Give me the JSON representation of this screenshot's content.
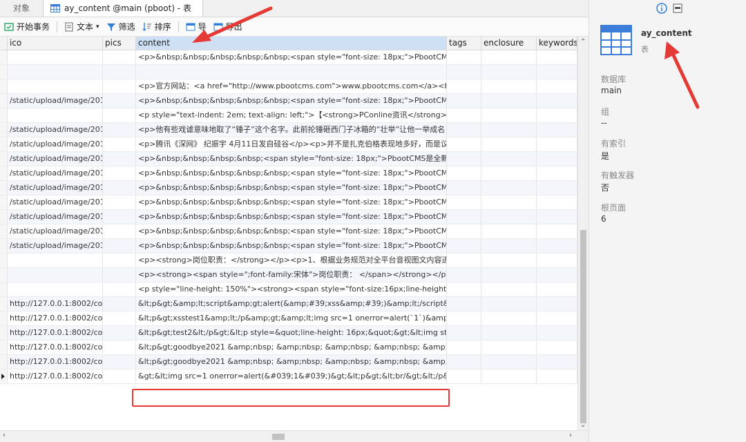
{
  "tabs": {
    "objects_label": "对象",
    "active_label": "ay_content @main (pboot) - 表"
  },
  "toolbar": {
    "begin_transaction": "开始事务",
    "text": "文本",
    "filter": "筛选",
    "sort": "排序",
    "import": "导",
    "export": "导出"
  },
  "columns": [
    "ico",
    "pics",
    "content",
    "tags",
    "enclosure",
    "keywords"
  ],
  "rows": [
    {
      "ico": "",
      "pics": "",
      "content": "<p>&nbsp;&nbsp;&nbsp;&nbsp;&nbsp;<span style=\"font-size: 18px;\">PbootCMS是全新"
    },
    {
      "ico": "",
      "pics": "",
      "content": ""
    },
    {
      "ico": "",
      "pics": "",
      "content": "<p>官方网站：<a href=\"http://www.pbootcms.com\">www.pbootcms.com</a><br/>"
    },
    {
      "ico": "/static/upload/image/201",
      "pics": "",
      "content": "<p>&nbsp;&nbsp;&nbsp;&nbsp;&nbsp;<span style=\"font-size: 18px;\">PbootCMS是全新"
    },
    {
      "ico": "",
      "pics": "",
      "content": "<p style=\"text-indent: 2em; text-align: left;\">【<strong>PConline资讯</strong>】20"
    },
    {
      "ico": "/static/upload/image/201",
      "pics": "",
      "content": "<p>他有些戏谑意味地取了“锤子”这个名字。此前抡锤砸西门子冰箱的“壮举”让他一举成名，"
    },
    {
      "ico": "/static/upload/image/201",
      "pics": "",
      "content": "<p>腾讯《深网》 纪振宇 4月11日发自硅谷</p><p>并不是扎克伯格表现地多好，而是议员"
    },
    {
      "ico": "/static/upload/image/201",
      "pics": "",
      "content": "<p>&nbsp;&nbsp;&nbsp;&nbsp;<span style=\"font-size: 18px;\">PbootCMS是全新内"
    },
    {
      "ico": "/static/upload/image/201",
      "pics": "",
      "content": "<p>&nbsp;&nbsp;&nbsp;&nbsp;&nbsp;<span style=\"font-size: 18px;\">PbootCMS是全新"
    },
    {
      "ico": "/static/upload/image/201",
      "pics": "",
      "content": "<p>&nbsp;&nbsp;&nbsp;&nbsp;&nbsp;<span style=\"font-size: 18px;\">PbootCMS是全新"
    },
    {
      "ico": "/static/upload/image/201",
      "pics": "",
      "content": "<p>&nbsp;&nbsp;&nbsp;&nbsp;&nbsp;<span style=\"font-size: 18px;\">PbootCMS是全新"
    },
    {
      "ico": "/static/upload/image/201",
      "pics": "",
      "content": "<p>&nbsp;&nbsp;&nbsp;&nbsp;&nbsp;<span style=\"font-size: 18px;\">PbootCMS是全新"
    },
    {
      "ico": "/static/upload/image/201",
      "pics": "",
      "content": "<p>&nbsp;&nbsp;&nbsp;&nbsp;&nbsp;<span style=\"font-size: 18px;\">PbootCMS是全新"
    },
    {
      "ico": "/static/upload/image/201",
      "pics": "",
      "content": "<p>&nbsp;&nbsp;&nbsp;&nbsp;&nbsp;<span style=\"font-size: 18px;\">PbootCMS是全新"
    },
    {
      "ico": "",
      "pics": "",
      "content": "<p><strong>岗位职责：</strong></p><p>1、根据业务规范对全平台音视图文内容进行"
    },
    {
      "ico": "",
      "pics": "",
      "content": "<p><strong><span style=\";font-family:宋体\">岗位职责： </span></strong></p><p"
    },
    {
      "ico": "",
      "pics": "",
      "content": "<p style=\"line-height: 150%\"><strong><span style=\"font-size:16px;line-height: 150%"
    },
    {
      "ico": "http://127.0.0.1:8002/core",
      "pics": "",
      "content": "&lt;p&gt;&amp;lt;script&amp;gt;alert(&amp;#39;xss&amp;#39;)&amp;lt;/script&amp"
    },
    {
      "ico": "http://127.0.0.1:8002/core",
      "pics": "",
      "content": "&lt;p&gt;xsstest1&amp;lt;/p&amp;gt;&amp;lt;img src=1 onerror=alert(`1`)&amp;gt;&"
    },
    {
      "ico": "http://127.0.0.1:8002/core",
      "pics": "",
      "content": "&lt;p&gt;test2&lt;/p&gt;&lt;p style=&quot;line-height: 16px;&quot;&gt;&lt;img style="
    },
    {
      "ico": "http://127.0.0.1:8002/core",
      "pics": "",
      "content": "&lt;p&gt;goodbye2021 &amp;nbsp; &amp;nbsp; &amp;nbsp; &amp;nbsp; &amp;nb"
    },
    {
      "ico": "http://127.0.0.1:8002/core",
      "pics": "",
      "content": "&lt;p&gt;goodbye2021 &amp;nbsp; &amp;nbsp; &amp;nbsp; &amp;nbsp; &amp;nb"
    },
    {
      "ico": "http://127.0.0.1:8002/core",
      "pics": "",
      "content": "&gt;&lt;img src=1 onerror=alert(&#039;1&#039;)&gt;&lt;p&gt;&lt;br/&gt;&lt;/p&gt;"
    }
  ],
  "panel": {
    "table_name": "ay_content",
    "object_type": "表",
    "database_label": "数据库",
    "database_value": "main",
    "group_label": "组",
    "group_value": "--",
    "has_index_label": "有索引",
    "has_index_value": "是",
    "has_trigger_label": "有触发器",
    "has_trigger_value": "否",
    "root_page_label": "根页面",
    "root_page_value": "6"
  },
  "colors": {
    "accent": "#3b7dd8",
    "highlight_box": "#e53935",
    "annotation_arrow": "#e53935",
    "header_selected": "#cfe0f5"
  },
  "icons": [
    "table-icon",
    "begin-transaction-icon",
    "text-icon",
    "filter-icon",
    "sort-icon",
    "import-icon",
    "export-icon",
    "info-icon",
    "ddl-icon"
  ]
}
